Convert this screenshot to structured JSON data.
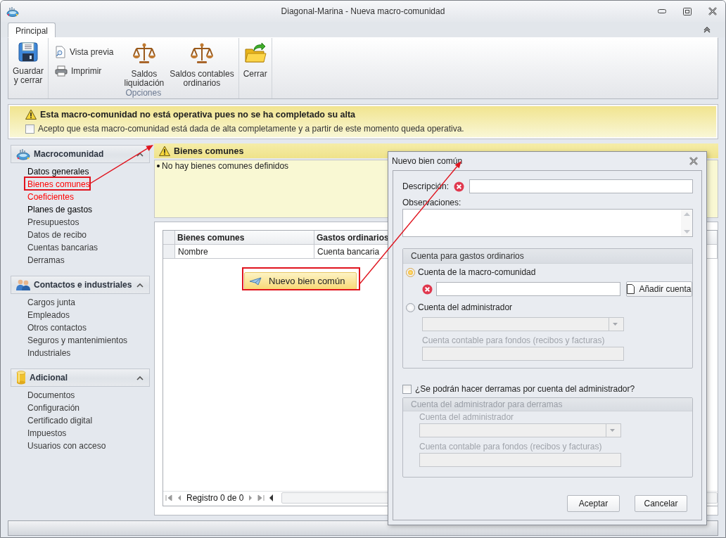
{
  "window": {
    "title": "Diagonal-Marina - Nueva macro-comunidad"
  },
  "ribbon": {
    "tabs": [
      {
        "label": "Principal",
        "selected": true
      }
    ],
    "groups": [
      {
        "items": [
          {
            "kind": "large",
            "label": "Guardar\ny cerrar"
          }
        ]
      },
      {
        "label": "Opciones",
        "items": [
          {
            "kind": "small",
            "label": "Vista previa"
          },
          {
            "kind": "small",
            "label": "Imprimir"
          },
          {
            "kind": "large",
            "label": "Saldos\nliquidación"
          },
          {
            "kind": "large",
            "label": "Saldos contables\nordinarios"
          }
        ]
      },
      {
        "items": [
          {
            "kind": "large",
            "label": "Cerrar"
          }
        ]
      }
    ]
  },
  "warning": {
    "title": "Esta macro-comunidad no está operativa pues no se ha completado su alta",
    "confirm": {
      "label": "Acepto que esta macro-comunidad está dada de alta completamente y a partir de este momento queda operativa.",
      "checked": false
    }
  },
  "sidebar": {
    "groups": [
      {
        "title": "Macrocomunidad",
        "expanded": true,
        "items": [
          {
            "label": "Datos generales",
            "color": "#000000"
          },
          {
            "label": "Bienes comunes",
            "color": "#ff0000"
          },
          {
            "label": "Coeficientes",
            "color": "#ff0000"
          },
          {
            "label": "Planes de gastos",
            "color": "#000000"
          },
          {
            "label": "Presupuestos",
            "color": "#3a3a3a"
          },
          {
            "label": "Datos de recibo",
            "color": "#3a3a3a"
          },
          {
            "label": "Cuentas bancarias",
            "color": "#3a3a3a"
          },
          {
            "label": "Derramas",
            "color": "#3a3a3a"
          }
        ]
      },
      {
        "title": "Contactos e industriales",
        "expanded": true,
        "items": [
          {
            "label": "Cargos junta",
            "color": "#3a3a3a"
          },
          {
            "label": "Empleados",
            "color": "#3a3a3a"
          },
          {
            "label": "Otros contactos",
            "color": "#3a3a3a"
          },
          {
            "label": "Seguros y mantenimientos",
            "color": "#3a3a3a"
          },
          {
            "label": "Industriales",
            "color": "#3a3a3a"
          }
        ]
      },
      {
        "title": "Adicional",
        "expanded": true,
        "items": [
          {
            "label": "Documentos",
            "color": "#3a3a3a"
          },
          {
            "label": "Configuración",
            "color": "#3a3a3a"
          },
          {
            "label": "Certificado digital",
            "color": "#3a3a3a"
          },
          {
            "label": "Impuestos",
            "color": "#3a3a3a"
          },
          {
            "label": "Usuarios con acceso",
            "color": "#3a3a3a"
          }
        ]
      }
    ]
  },
  "section": {
    "title": "Bienes comunes",
    "messages": [
      "No hay bienes comunes definidos"
    ]
  },
  "grid": {
    "columns": [
      "Bienes comunes",
      "Gastos ordinarios"
    ],
    "filter_row": [
      "Nombre",
      "Cuenta bancaria"
    ],
    "action": "Nuevo bien común",
    "pager": "Registro 0 de 0"
  },
  "dialog": {
    "title": "Nuevo bien común",
    "description": {
      "label": "Descripción:",
      "error": true
    },
    "observations": {
      "label": "Observaciones:"
    },
    "ordinary_account": {
      "title": "Cuenta para gastos ordinarios",
      "options": [
        {
          "label": "Cuenta de la macro-comunidad",
          "selected": true
        },
        {
          "label": "Cuenta del administrador",
          "selected": false
        }
      ],
      "account_error": true,
      "add_button": "Añadir cuenta",
      "fund_label": "Cuenta contable para fondos (recibos y facturas)"
    },
    "levies": {
      "label": "¿Se podrán hacer derramas por cuenta del administrador?",
      "checked": false,
      "title": "Cuenta del administrador para derramas",
      "admin_label": "Cuenta del administrador",
      "fund_label": "Cuenta contable para fondos (recibos y facturas)"
    },
    "buttons": [
      "Aceptar",
      "Cancelar"
    ]
  }
}
